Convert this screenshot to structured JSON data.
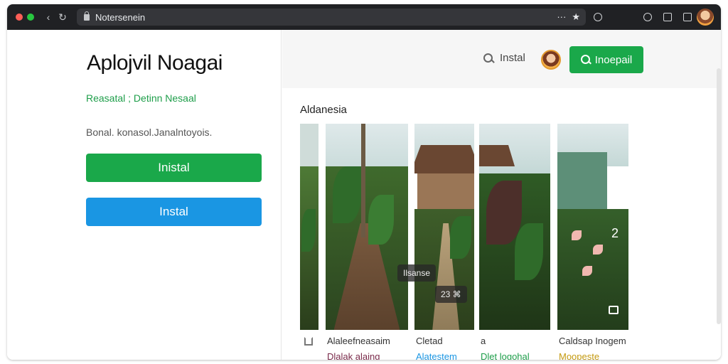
{
  "browser": {
    "url": "Notersenein",
    "nav_back": "‹",
    "nav_reload": "↻",
    "url_more": "···",
    "url_star": "★"
  },
  "left": {
    "app_title": "Aplojvil Noagai",
    "breadcrumb": "Reasatal ; Detinn Nesaal",
    "description": "Bonal. konasol.Janalntoyois.",
    "primary_button": "Inistal",
    "secondary_button": "Instal"
  },
  "right": {
    "search_link": "Instal",
    "install_button": "Inoepail",
    "section_title": "Aldanesia",
    "cards": [
      {
        "caption": "",
        "subcaption": ""
      },
      {
        "caption": "Alaleefneasaim",
        "subcaption": "Dlalak alaing"
      },
      {
        "caption": "Cletad",
        "subcaption": "Alatestem"
      },
      {
        "caption": "a",
        "subcaption": "Dlet logohal"
      },
      {
        "caption": "Caldsap Inogem",
        "subcaption": "Moopeste"
      }
    ],
    "overlays": {
      "center_tag": "Ilsanse",
      "counter_tag": "23 ⌘",
      "side_tag": "2"
    }
  },
  "colors": {
    "accent_green": "#1aa84a",
    "accent_blue": "#1a96e3",
    "chrome_dark": "#202124"
  }
}
